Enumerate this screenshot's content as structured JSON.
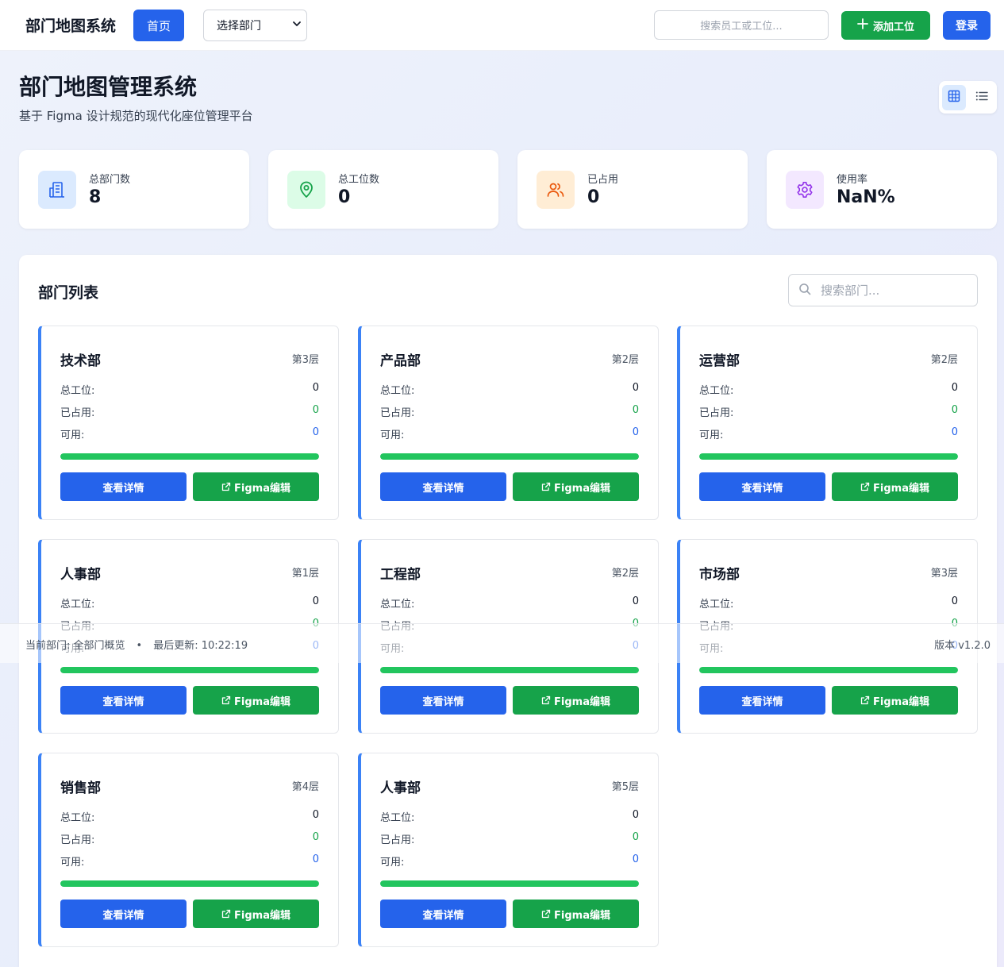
{
  "nav": {
    "brand": "部门地图系统",
    "home_label": "首页",
    "select_value": "选择部门",
    "search_placeholder": "搜索员工或工位...",
    "add_label": "添加工位",
    "login_label": "登录"
  },
  "header": {
    "title": "部门地图管理系统",
    "subtitle": "基于 Figma 设计规范的现代化座位管理平台"
  },
  "view_toggle": {
    "active": "grid-view",
    "options": [
      "grid-view",
      "list-view"
    ]
  },
  "stats": [
    {
      "label": "总部门数",
      "value": "8",
      "icon": "building-icon",
      "bg": "#dbeafe",
      "color": "#2563eb"
    },
    {
      "label": "总工位数",
      "value": "0",
      "icon": "map-pin-icon",
      "bg": "#dcfce7",
      "color": "#16a34a"
    },
    {
      "label": "已占用",
      "value": "0",
      "icon": "users-icon",
      "bg": "#ffedd5",
      "color": "#ea580c"
    },
    {
      "label": "使用率",
      "value": "NaN%",
      "icon": "gear-icon",
      "bg": "#f3e8ff",
      "color": "#9333ea"
    }
  ],
  "list": {
    "title": "部门列表",
    "search_placeholder": "搜索部门..."
  },
  "card_labels": {
    "total": "总工位:",
    "occupied": "已占用:",
    "available": "可用:",
    "detail_button": "查看详情",
    "figma_button": "Figma编辑"
  },
  "departments": [
    {
      "name": "技术部",
      "floor": "第3层",
      "total": "0",
      "occupied": "0",
      "available": "0",
      "bar_fill_pct": 100
    },
    {
      "name": "产品部",
      "floor": "第2层",
      "total": "0",
      "occupied": "0",
      "available": "0",
      "bar_fill_pct": 100
    },
    {
      "name": "运营部",
      "floor": "第2层",
      "total": "0",
      "occupied": "0",
      "available": "0",
      "bar_fill_pct": 100
    },
    {
      "name": "人事部",
      "floor": "第1层",
      "total": "0",
      "occupied": "0",
      "available": "0",
      "bar_fill_pct": 100
    },
    {
      "name": "工程部",
      "floor": "第2层",
      "total": "0",
      "occupied": "0",
      "available": "0",
      "bar_fill_pct": 100
    },
    {
      "name": "市场部",
      "floor": "第3层",
      "total": "0",
      "occupied": "0",
      "available": "0",
      "bar_fill_pct": 100
    },
    {
      "name": "销售部",
      "floor": "第4层",
      "total": "0",
      "occupied": "0",
      "available": "0",
      "bar_fill_pct": 100
    },
    {
      "name": "人事部",
      "floor": "第5层",
      "total": "0",
      "occupied": "0",
      "available": "0",
      "bar_fill_pct": 100
    }
  ],
  "footer": {
    "current_dept": "当前部门: 全部门概览",
    "last_update": "最后更新: 10:22:19",
    "version": "版本 v1.2.0"
  },
  "colors": {
    "primary": "#2563eb",
    "success": "#16a34a",
    "bar_fill": "#22c55e",
    "card_accent": "#3b82f6"
  }
}
